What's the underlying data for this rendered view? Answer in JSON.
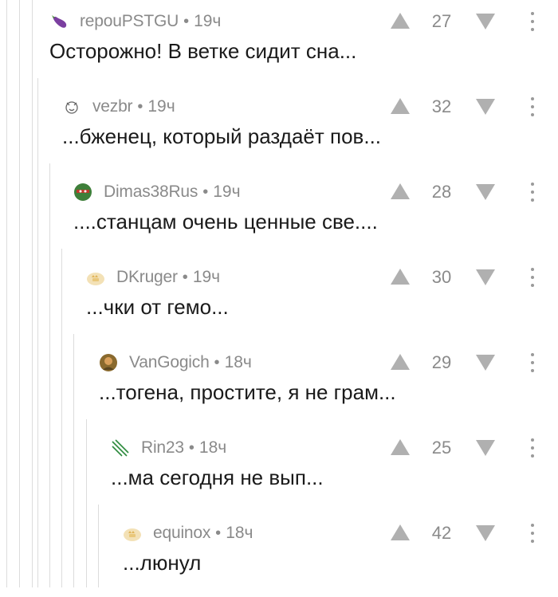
{
  "colors": {
    "meta_text": "#8a8a8a",
    "body_text": "#1a1a1a",
    "thread_line": "#dcdcdc",
    "vote_icon": "#b0b0b0",
    "more_dots": "#9a9a9a"
  },
  "separator": "•",
  "comments": [
    {
      "author": "repouPSTGU",
      "time": "19ч",
      "text": "Осторожно! В ветке сидит сна...",
      "rating": "27",
      "avatar_icon": "eggplant-icon"
    },
    {
      "author": "vezbr",
      "time": "19ч",
      "text": "...бженец, который раздаёт пов...",
      "rating": "32",
      "avatar_icon": "sketch-avatar-icon"
    },
    {
      "author": "Dimas38Rus",
      "time": "19ч",
      "text": "....станцам очень ценные све....",
      "rating": "28",
      "avatar_icon": "turtle-avatar-icon"
    },
    {
      "author": "DKruger",
      "time": "19ч",
      "text": "...чки от гемо...",
      "rating": "30",
      "avatar_icon": "default-avatar-icon"
    },
    {
      "author": "VanGogich",
      "time": "18ч",
      "text": "...тогена, простите, я не грам...",
      "rating": "29",
      "avatar_icon": "portrait-avatar-icon"
    },
    {
      "author": "Rin23",
      "time": "18ч",
      "text": "...ма сегодня не вып...",
      "rating": "25",
      "avatar_icon": "claw-avatar-icon"
    },
    {
      "author": "equinox",
      "time": "18ч",
      "text": "...люнул",
      "rating": "42",
      "avatar_icon": "default-avatar-icon"
    }
  ]
}
